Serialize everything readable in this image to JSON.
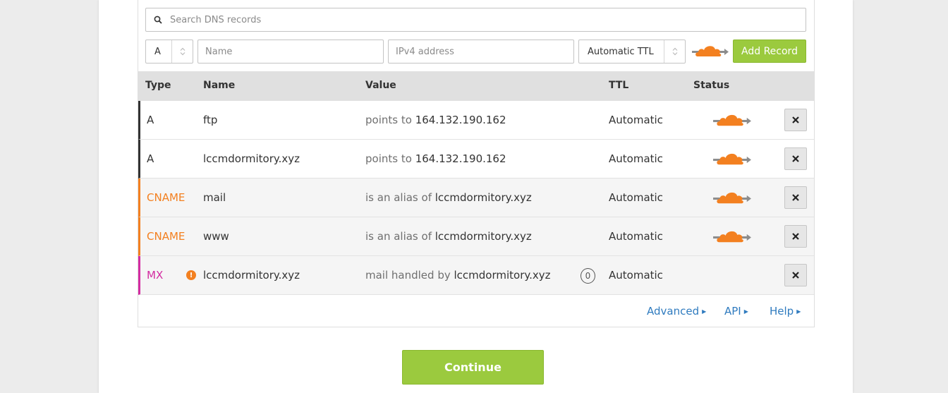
{
  "search": {
    "placeholder": "Search DNS records"
  },
  "add_record": {
    "type_value": "A",
    "name_placeholder": "Name",
    "value_placeholder": "IPv4 address",
    "ttl_value": "Automatic TTL",
    "proxy_icon": "cloud-proxied-icon",
    "add_label": "Add Record"
  },
  "table": {
    "headers": {
      "type": "Type",
      "name": "Name",
      "value": "Value",
      "ttl": "TTL",
      "status": "Status"
    },
    "rows": [
      {
        "type": "A",
        "name": "ftp",
        "value_prefix": "points to",
        "value": "164.132.190.162",
        "ttl": "Automatic",
        "proxied": true,
        "type_color": "#333333"
      },
      {
        "type": "A",
        "name": "lccmdormitory.xyz",
        "value_prefix": "points to",
        "value": "164.132.190.162",
        "ttl": "Automatic",
        "proxied": true,
        "type_color": "#333333"
      },
      {
        "type": "CNAME",
        "name": "mail",
        "value_prefix": "is an alias of",
        "value": "lccmdormitory.xyz",
        "ttl": "Automatic",
        "proxied": true,
        "type_color": "#f38020"
      },
      {
        "type": "CNAME",
        "name": "www",
        "value_prefix": "is an alias of",
        "value": "lccmdormitory.xyz",
        "ttl": "Automatic",
        "proxied": true,
        "type_color": "#f38020"
      },
      {
        "type": "MX",
        "name": "lccmdormitory.xyz",
        "value_prefix": "mail handled by",
        "value": "lccmdormitory.xyz",
        "priority": "0",
        "ttl": "Automatic",
        "proxied": false,
        "type_color": "#d32ca1",
        "warning": "!"
      }
    ]
  },
  "footer_links": {
    "advanced": "Advanced",
    "api": "API",
    "help": "Help"
  },
  "continue_label": "Continue",
  "colors": {
    "accent_green": "#9bca3e",
    "cloud_orange": "#f38020",
    "link_blue": "#2f7bbf",
    "mx_magenta": "#d32ca1"
  }
}
